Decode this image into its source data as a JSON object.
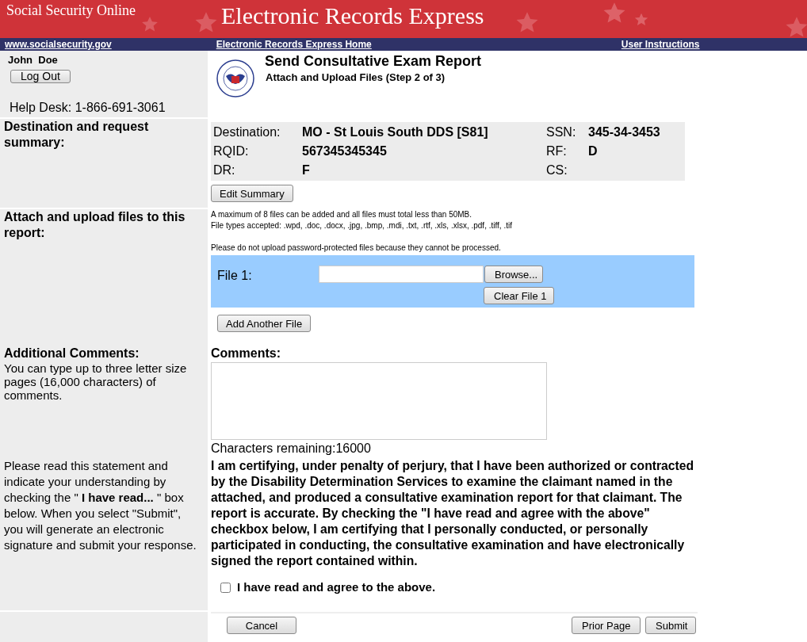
{
  "banner": {
    "site_name": "Social Security Online",
    "title": "Electronic Records Express"
  },
  "nav": [
    {
      "label": "www.socialsecurity.gov"
    },
    {
      "label": "Electronic Records Express Home"
    },
    {
      "label": "User Instructions"
    }
  ],
  "user": {
    "name": "John  Doe",
    "logout": "Log Out",
    "help_desk": "Help Desk: 1-866-691-3061"
  },
  "page": {
    "title": "Send Consultative Exam Report",
    "subtitle": "Attach and Upload Files (Step 2 of 3)"
  },
  "summary": {
    "heading": "Destination and request summary:",
    "fields": [
      {
        "label": "Destination:",
        "value": "MO - St Louis South DDS [S81]"
      },
      {
        "label": "SSN:",
        "value": "345-34-3453"
      },
      {
        "label": "RQID:",
        "value": "567345345345"
      },
      {
        "label": "RF:",
        "value": "D"
      },
      {
        "label": "DR:",
        "value": "F"
      },
      {
        "label": "CS:"
      }
    ],
    "edit_button": "Edit Summary"
  },
  "attach": {
    "heading": "Attach and upload files to this report:",
    "notes": [
      "A maximum of 8 files can be added and all files must total less than 50MB.",
      "File types accepted: .wpd, .doc, .docx, .jpg, .bmp, .mdi, .txt, .rtf, .xls, .xlsx, .pdf, .tiff, .tif"
    ],
    "warning": "Please do not upload password-protected files because they cannot be processed.",
    "files": [
      {
        "label": "File 1:",
        "browse": "Browse...",
        "clear": "Clear File 1"
      }
    ],
    "add_button": "Add Another File"
  },
  "comments": {
    "heading": "Additional Comments:",
    "help": "You can type up to three letter size pages (16,000 characters) of comments.",
    "label": "Comments:",
    "remaining": "Characters remaining:16000"
  },
  "statement": {
    "instructions": "Please read this statement and indicate your understanding by checking the \" **I have read...** \" box below. When you select \"Submit\", you will generate an electronic signature and submit your response.",
    "text": "I am certifying, under penalty of perjury, that I have been authorized or contracted by the Disability Determination Services to examine the claimant named in the attached, and produced a consultative examination report for that claimant. The report is accurate. By checking the \"I have read and agree with the above\" checkbox below, I am certifying that I personally conducted, or personally participated in conducting, the consultative examination and have electronically signed the report contained within.",
    "agree": {
      "label": "I have read and agree to the above.",
      "checked": false
    }
  },
  "buttons": {
    "cancel": "Cancel",
    "prior": "Prior Page",
    "submit": "Submit"
  }
}
